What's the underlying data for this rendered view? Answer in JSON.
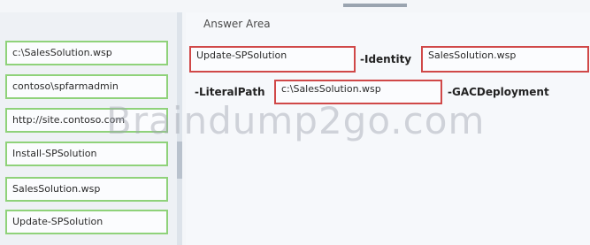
{
  "source_items": [
    "c:\\SalesSolution.wsp",
    "contoso\\spfarmadmin",
    "http://site.contoso.com",
    "Install-SPSolution",
    "SalesSolution.wsp",
    "Update-SPSolution"
  ],
  "answer_area": {
    "title": "Answer Area",
    "row1": {
      "slot1": "Update-SPSolution",
      "kw_identity": "-Identity",
      "slot2": "SalesSolution.wsp"
    },
    "row2": {
      "kw_literalpath": "-LiteralPath",
      "slot3": "c:\\SalesSolution.wsp",
      "kw_gac": "-GACDeployment"
    }
  },
  "watermark": "Braindump2go.com",
  "colors": {
    "source_border": "#8fd27a",
    "slot_border": "#d04848"
  }
}
